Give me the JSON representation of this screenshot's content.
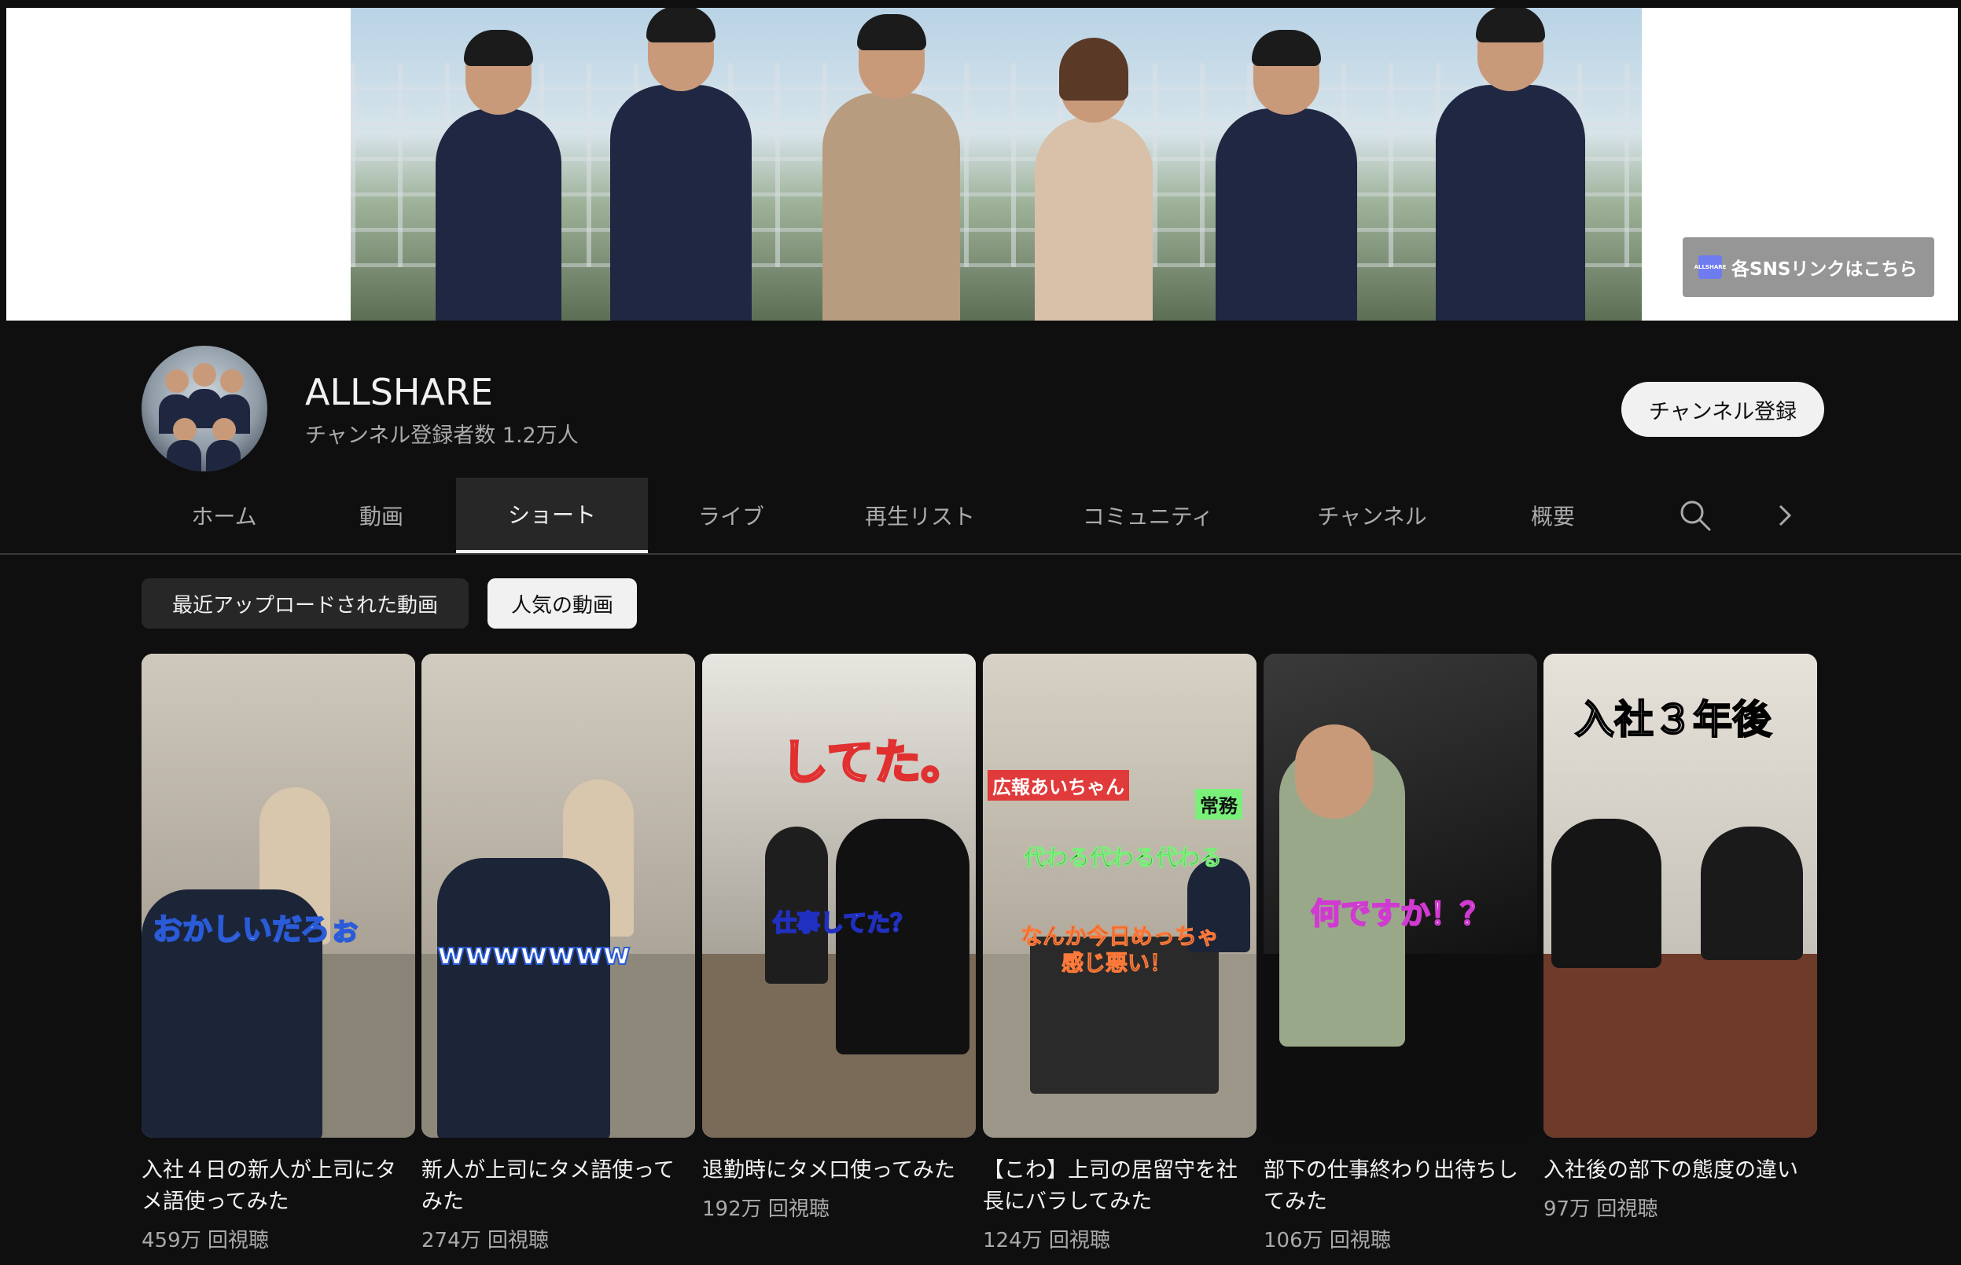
{
  "banner": {
    "sns_label": "各SNSリンクはこちら",
    "sns_logo_text": "ALLSHARE"
  },
  "channel": {
    "name": "ALLSHARE",
    "subscribers": "チャンネル登録者数 1.2万人",
    "subscribe_label": "チャンネル登録"
  },
  "tabs": [
    {
      "label": "ホーム"
    },
    {
      "label": "動画"
    },
    {
      "label": "ショート"
    },
    {
      "label": "ライブ"
    },
    {
      "label": "再生リスト"
    },
    {
      "label": "コミュニティ"
    },
    {
      "label": "チャンネル"
    },
    {
      "label": "概要"
    }
  ],
  "active_tab": "ショート",
  "chips": [
    {
      "label": "最近アップロードされた動画"
    },
    {
      "label": "人気の動画"
    }
  ],
  "selected_chip": "人気の動画",
  "shorts": [
    {
      "title": "入社４日の新人が上司にタメ語使ってみた",
      "views": "459万 回視聴",
      "caption": "おかしいだろぉ"
    },
    {
      "title": "新人が上司にタメ語使ってみた",
      "views": "274万 回視聴",
      "caption": "wwwwwww"
    },
    {
      "title": "退勤時にタメ口使ってみた",
      "views": "192万 回視聴",
      "caption": "してた。",
      "caption2": "仕事してた？"
    },
    {
      "title": "【こわ】上司の居留守を社長にバラしてみた",
      "views": "124万 回視聴",
      "caption": "広報あいちゃん",
      "caption2": "常務",
      "caption3": "代わる代わる代わる",
      "caption4": "なんか今日めっちゃ",
      "caption5": "感じ悪い！"
    },
    {
      "title": "部下の仕事終わり出待ちしてみた",
      "views": "106万 回視聴",
      "caption": "何ですか！？"
    },
    {
      "title": "入社後の部下の態度の違い",
      "views": "97万 回視聴",
      "caption": "入社３年後"
    }
  ],
  "colors": {
    "background": "#0f0f0f",
    "chip_dark": "#272727",
    "text_secondary": "#aaaaaa"
  }
}
